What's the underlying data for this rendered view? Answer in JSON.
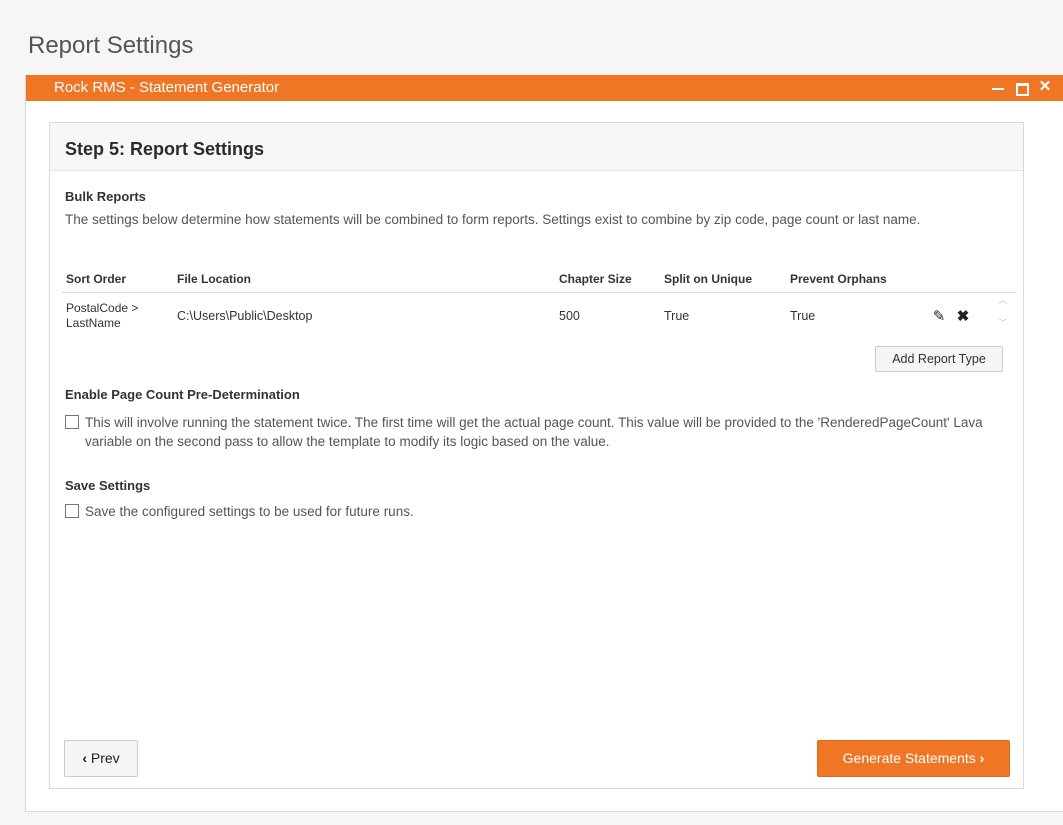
{
  "page": {
    "heading": "Report Settings"
  },
  "window": {
    "title": "Rock RMS - Statement Generator",
    "controls": {
      "minimize": "minimize-icon",
      "maximize": "maximize-icon",
      "close": "close-icon"
    }
  },
  "step": {
    "title": "Step 5: Report Settings",
    "bulk_reports": {
      "label": "Bulk Reports",
      "description": "The settings below determine how statements will be combined to form reports. Settings exist to combine by zip code, page count or last name.",
      "columns": [
        "Sort Order",
        "File Location",
        "Chapter Size",
        "Split on Unique",
        "Prevent Orphans"
      ],
      "rows": [
        {
          "sort_order_line1": "PostalCode >",
          "sort_order_line2": "LastName",
          "file_location": "C:\\Users\\Public\\Desktop",
          "chapter_size": "500",
          "split_on_unique": "True",
          "prevent_orphans": "True"
        }
      ],
      "add_button": "Add Report Type"
    },
    "page_count": {
      "label": "Enable Page Count Pre-Determination",
      "checkbox_text": "This will involve running the statement twice. The first time will get the actual page count. This value will be provided to the 'RenderedPageCount' Lava variable on the second pass to allow the template to modify its logic based on the value.",
      "checked": false
    },
    "save_settings": {
      "label": "Save Settings",
      "checkbox_text": "Save the configured settings to be used for future runs.",
      "checked": false
    },
    "buttons": {
      "prev": "Prev",
      "generate": "Generate Statements"
    }
  },
  "colors": {
    "accent": "#ee7625"
  }
}
